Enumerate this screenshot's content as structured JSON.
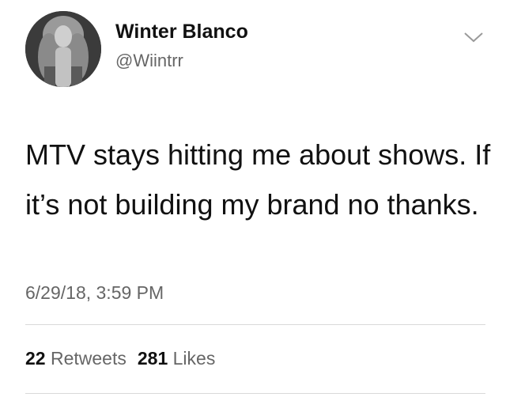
{
  "user": {
    "display_name": "Winter Blanco",
    "handle": "@Wiintrr"
  },
  "tweet": {
    "text": "MTV stays hitting me about shows. If it’s not building my brand no thanks.",
    "timestamp": "6/29/18, 3:59 PM"
  },
  "stats": {
    "retweets_count": "22",
    "retweets_label": "Retweets",
    "likes_count": "281",
    "likes_label": "Likes"
  },
  "icons": {
    "menu": "chevron-down-icon"
  },
  "colors": {
    "text": "#111111",
    "secondary_text": "#666666",
    "divider": "#d9d9d9"
  }
}
